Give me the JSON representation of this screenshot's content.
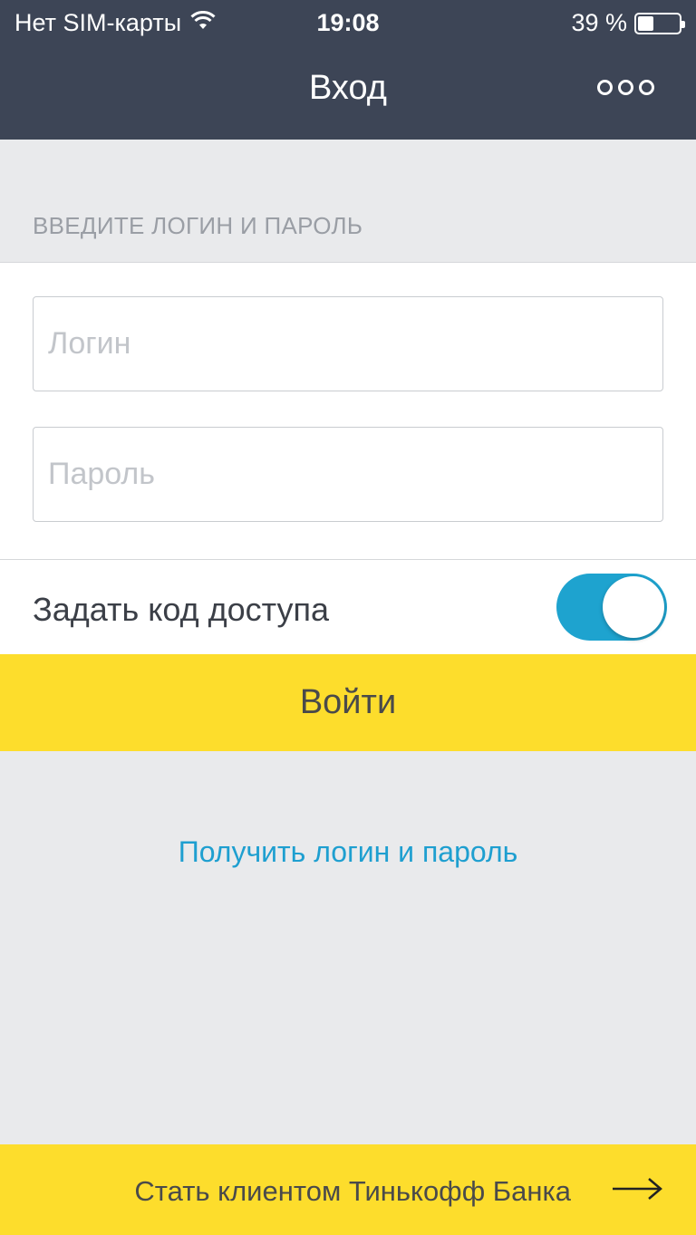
{
  "status_bar": {
    "carrier": "Нет SIM-карты",
    "time": "19:08",
    "battery": "39 %",
    "battery_level": 0.39
  },
  "nav": {
    "title": "Вход",
    "more_icon": "more-options-icon"
  },
  "form": {
    "section_header": "ВВЕДИТЕ ЛОГИН И ПАРОЛЬ",
    "login_placeholder": "Логин",
    "password_placeholder": "Пароль",
    "passcode_toggle_label": "Задать код доступа",
    "passcode_toggle_on": true
  },
  "actions": {
    "login_button": "Войти",
    "get_credentials_link": "Получить логин и пароль",
    "become_client": "Стать клиентом Тинькофф Банка"
  },
  "colors": {
    "nav_bg": "#3d4556",
    "accent_yellow": "#fddd2c",
    "link_blue": "#1e9fd0",
    "toggle_blue": "#1ea3cf",
    "background": "#e9eaec"
  }
}
